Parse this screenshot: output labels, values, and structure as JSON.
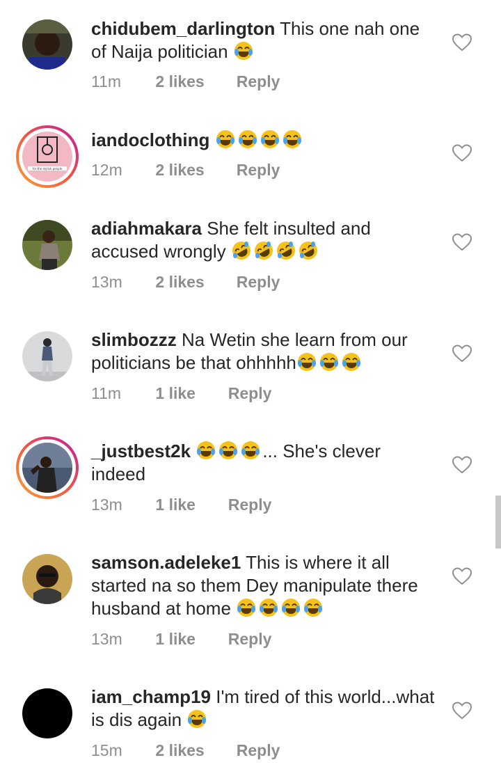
{
  "comments": [
    {
      "username": "chidubem_darlington",
      "text": "This one nah one of Naija politician",
      "emoji_count": 1,
      "emoji": "laughing-tears",
      "time": "11m",
      "likes": "2 likes",
      "reply": "Reply"
    },
    {
      "username": "iandoclothing",
      "text": "",
      "emoji_count": 4,
      "emoji": "laughing-tears",
      "time": "12m",
      "likes": "2 likes",
      "reply": "Reply",
      "avatar_text": "for the stylish people"
    },
    {
      "username": "adiahmakara",
      "text": "She felt insulted and accused wrongly",
      "emoji_count": 4,
      "emoji": "rolling-on-floor-laughing",
      "time": "13m",
      "likes": "2 likes",
      "reply": "Reply"
    },
    {
      "username": "slimbozzz",
      "text": "Na Wetin she learn from our politicians be that ohhhhh",
      "emoji_count": 3,
      "emoji": "laughing-tears",
      "time": "11m",
      "likes": "1 like",
      "reply": "Reply"
    },
    {
      "username": "_justbest2k",
      "text": "... She's clever indeed",
      "emoji_count": 3,
      "emoji": "laughing-tears",
      "time": "13m",
      "likes": "1 like",
      "reply": "Reply"
    },
    {
      "username": "samson.adeleke1",
      "text": "This is where it all started na so them Dey manipulate there husband at home",
      "emoji_count": 4,
      "emoji": "laughing-tears",
      "time": "13m",
      "likes": "1 like",
      "reply": "Reply"
    },
    {
      "username": "iam_champ19",
      "text": "I'm tired of this world...what is dis again",
      "emoji_count": 1,
      "emoji": "laughing-tears",
      "time": "15m",
      "likes": "2 likes",
      "reply": "Reply"
    }
  ],
  "colors": {
    "text": "#262626",
    "meta": "#8e8e8e",
    "emoji": "#f5c21b"
  }
}
